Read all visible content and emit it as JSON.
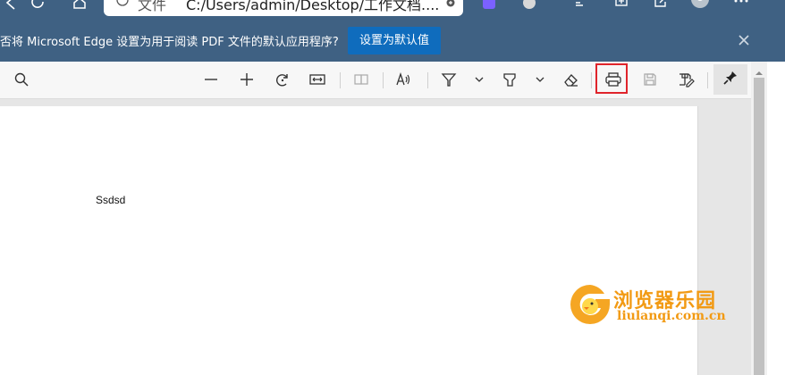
{
  "browser": {
    "address": {
      "file_label": "文件",
      "url": "C:/Users/admin/Desktop/工作文档...."
    }
  },
  "banner": {
    "message": "否将 Microsoft Edge 设置为用于阅读 PDF 文件的默认应用程序?",
    "button_label": "设置为默认值"
  },
  "pdf_toolbar": {
    "tools": [
      "search",
      "zoom-out",
      "zoom-in",
      "rotate",
      "fit-page",
      "page-view",
      "read-aloud",
      "draw",
      "highlight",
      "erase",
      "print",
      "save",
      "save-as",
      "pin"
    ],
    "highlighted_tool": "print",
    "highlight_color": "#e0242b"
  },
  "document": {
    "text": "Ssdsd"
  },
  "watermark": {
    "name_cn": "浏览器乐园",
    "site": "liulanqi.com.cn",
    "color": "#f29a13"
  },
  "colors": {
    "banner_bg": "#3f6183",
    "button_bg": "#0f6cbd"
  }
}
